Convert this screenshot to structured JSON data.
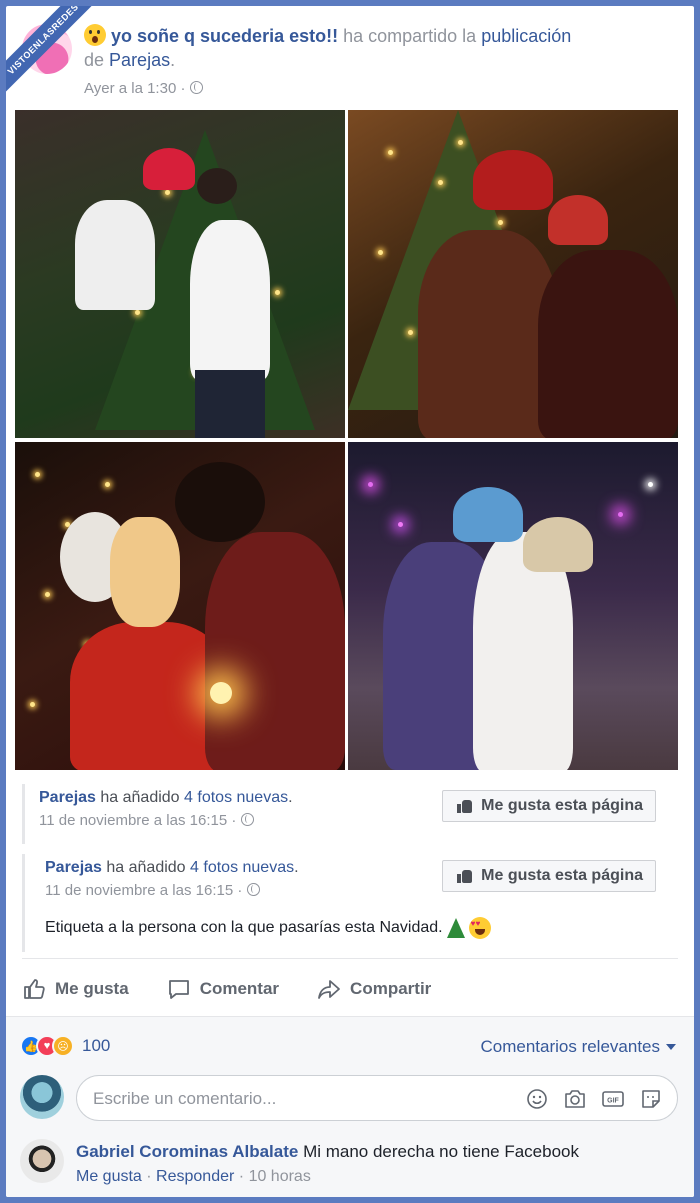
{
  "watermark": "VISTOENLASREDES",
  "post": {
    "author": "yo soñe q sucederia esto!!",
    "action_text": "ha compartido la",
    "object_link": "publicación",
    "object_of": "de",
    "page_name": "Parejas",
    "period": ".",
    "timestamp": "Ayer a la 1:30",
    "separator": "·",
    "author_emoji_icon": "astonished-face-icon"
  },
  "photos": [
    {
      "name": "photo-couple-ladder-tree"
    },
    {
      "name": "photo-couple-santa-hats"
    },
    {
      "name": "photo-couple-candle"
    },
    {
      "name": "photo-couple-night-lights"
    }
  ],
  "shared1": {
    "page": "Parejas",
    "text": "ha añadido",
    "count_link": "4 fotos nuevas",
    "period": ".",
    "timestamp": "11 de noviembre a las 16:15",
    "separator": "·",
    "like_page_label": "Me gusta esta página"
  },
  "shared2": {
    "page": "Parejas",
    "text": "ha añadido",
    "count_link": "4 fotos nuevas",
    "period": ".",
    "timestamp": "11 de noviembre a las 16:15",
    "separator": "·",
    "like_page_label": "Me gusta esta página",
    "body": "Etiqueta a la persona con la que pasarías esta Navidad."
  },
  "actions": {
    "like": "Me gusta",
    "comment": "Comentar",
    "share": "Compartir"
  },
  "reactions": {
    "count": "100",
    "sort_label": "Comentarios relevantes"
  },
  "composer": {
    "placeholder": "Escribe un comentario..."
  },
  "comment": {
    "author": "Gabriel Corominas Albalate",
    "text": "Mi mano derecha no tiene Facebook",
    "like_label": "Me gusta",
    "reply_label": "Responder",
    "time": "10 horas",
    "separator": "·"
  },
  "colors": {
    "link": "#365899",
    "muted": "#90949c",
    "background": "#5b7bc0"
  }
}
